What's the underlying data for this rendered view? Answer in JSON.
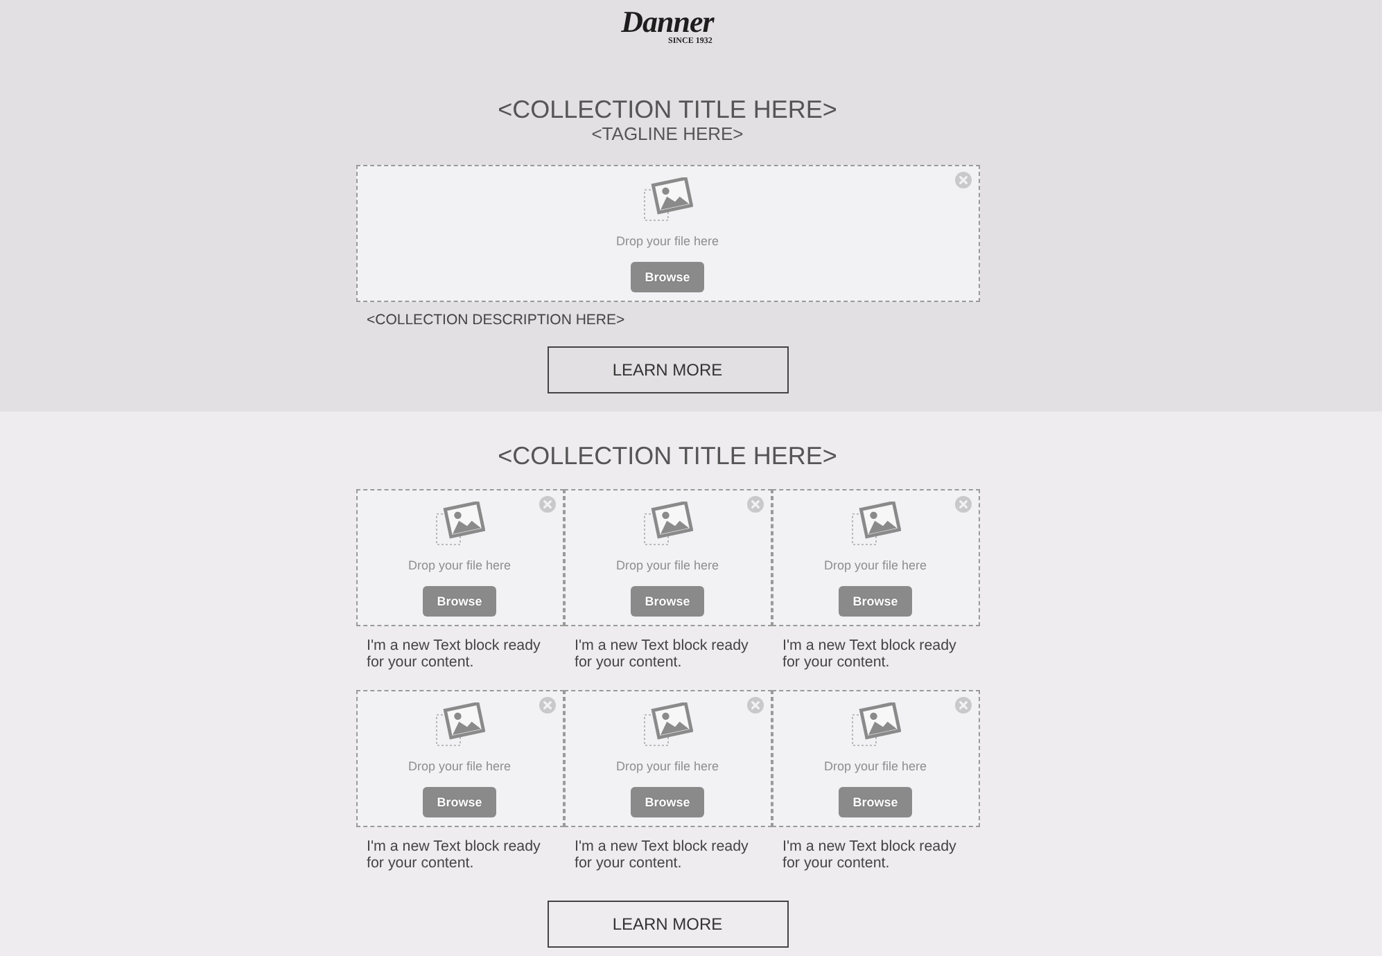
{
  "logo": {
    "wordmark": "Danner",
    "since": "SINCE 1932"
  },
  "hero": {
    "title": "<COLLECTION TITLE HERE>",
    "tagline": "<TAGLINE HERE>",
    "dropzone": {
      "prompt": "Drop your file here",
      "button": "Browse"
    },
    "description": "<COLLECTION DESCRIPTION HERE>",
    "button": "LEARN MORE"
  },
  "collection": {
    "title": "<COLLECTION TITLE HERE>",
    "items": [
      {
        "dropzone": {
          "prompt": "Drop your file here",
          "button": "Browse"
        },
        "text": "I'm a new Text block ready for your content."
      },
      {
        "dropzone": {
          "prompt": "Drop your file here",
          "button": "Browse"
        },
        "text": "I'm a new Text block ready for your content."
      },
      {
        "dropzone": {
          "prompt": "Drop your file here",
          "button": "Browse"
        },
        "text": "I'm a new Text block ready for your content."
      },
      {
        "dropzone": {
          "prompt": "Drop your file here",
          "button": "Browse"
        },
        "text": "I'm a new Text block ready for your content."
      },
      {
        "dropzone": {
          "prompt": "Drop your file here",
          "button": "Browse"
        },
        "text": "I'm a new Text block ready for your content."
      },
      {
        "dropzone": {
          "prompt": "Drop your file here",
          "button": "Browse"
        },
        "text": "I'm a new Text block ready for your content."
      }
    ],
    "button": "LEARN MORE"
  }
}
